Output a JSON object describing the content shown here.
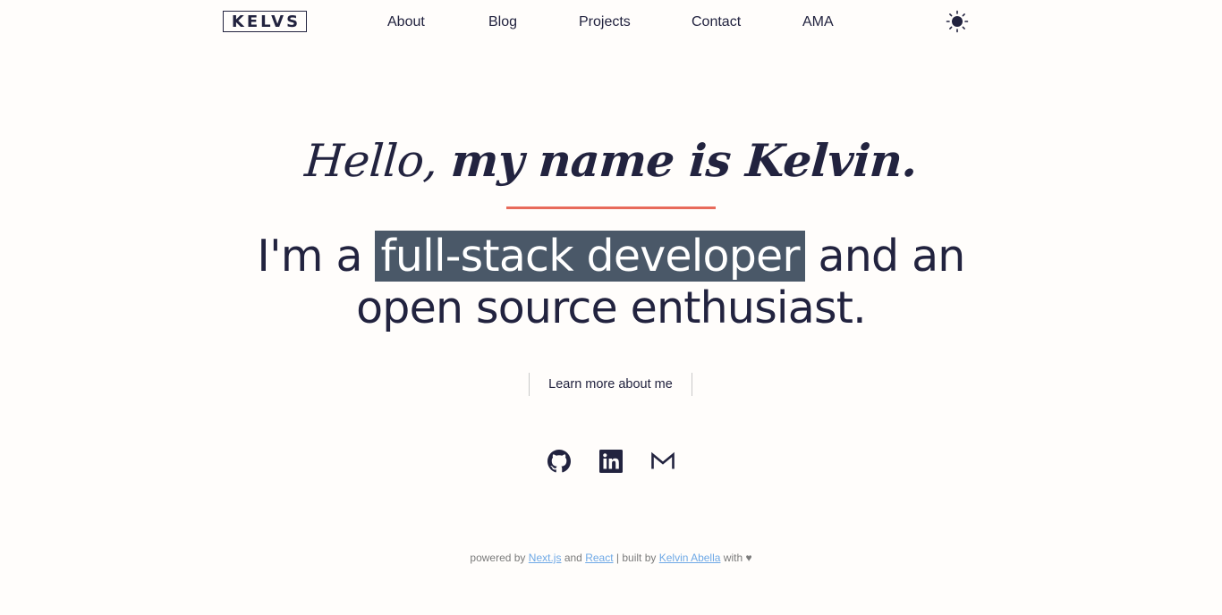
{
  "header": {
    "logo": "KELVS",
    "nav": [
      {
        "label": "About"
      },
      {
        "label": "Blog"
      },
      {
        "label": "Projects"
      },
      {
        "label": "Contact"
      },
      {
        "label": "AMA"
      }
    ],
    "theme_toggle_icon": "sun-icon"
  },
  "hero": {
    "greeting_light": "Hello,",
    "greeting_bold": "my name is Kelvin.",
    "tagline_before": "I'm a",
    "tagline_highlight": "full-stack developer",
    "tagline_after": "and an",
    "tagline_line2": "open source enthusiast.",
    "learn_more": "Learn more about me",
    "accent_color": "#e86a5a",
    "highlight_color": "#4a5868"
  },
  "social": [
    {
      "icon": "github-icon"
    },
    {
      "icon": "linkedin-icon"
    },
    {
      "icon": "gmail-icon"
    }
  ],
  "footer": {
    "powered_by": "powered by",
    "nextjs": "Next.js",
    "and": "and",
    "react": "React",
    "built_by": "| built by",
    "author": "Kelvin Abella",
    "with": "with",
    "heart": "♥"
  }
}
